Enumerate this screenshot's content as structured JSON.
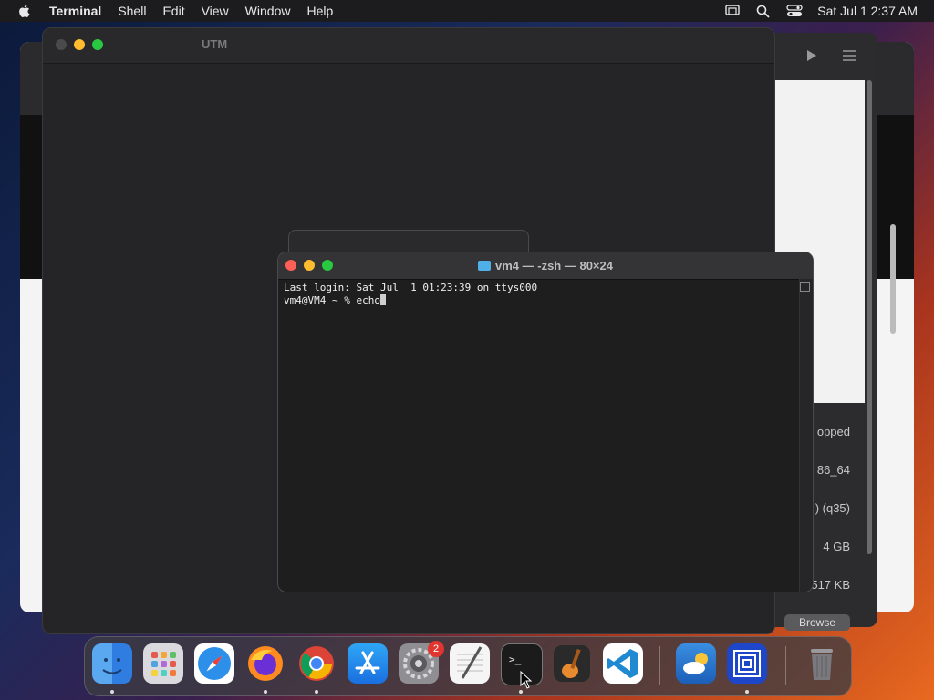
{
  "menubar": {
    "app_name": "Terminal",
    "items": [
      "Shell",
      "Edit",
      "View",
      "Window",
      "Help"
    ],
    "clock": "Sat Jul 1  2:37 AM"
  },
  "utm": {
    "title": "UTM",
    "details": [
      "opped",
      "86_64",
      ") (q35)",
      "4 GB",
      "517 KB"
    ],
    "browse_label": "Browse"
  },
  "terminal": {
    "title": "vm4 — -zsh — 80×24",
    "line1": "Last login: Sat Jul  1 01:23:39 on ttys000",
    "prompt": "vm4@VM4 ~ % ",
    "command": "echo"
  },
  "dock": {
    "badge_settings": "2"
  },
  "colors": {
    "close": "#fe5f57",
    "minimize": "#febc2e",
    "zoom": "#28c840",
    "inactive_dot": "#4a4a4c"
  }
}
